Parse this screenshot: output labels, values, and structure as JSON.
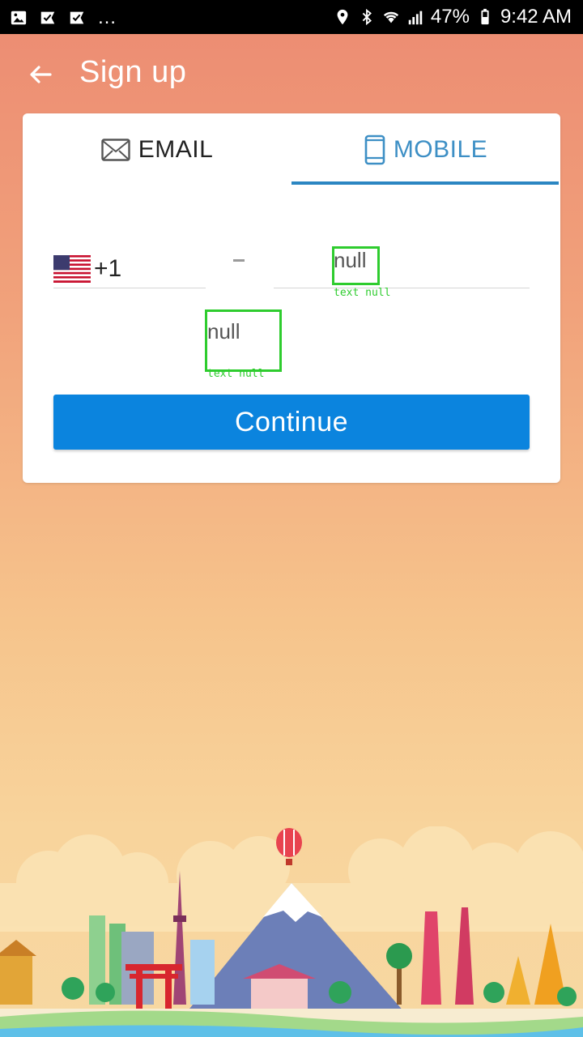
{
  "status_bar": {
    "battery": "47%",
    "time": "9:42 AM",
    "more": "…"
  },
  "header": {
    "title": "Sign up"
  },
  "tabs": [
    {
      "label": "EMAIL",
      "icon": "envelope-icon",
      "selected": false
    },
    {
      "label": "MOBILE",
      "icon": "phone-icon",
      "selected": true
    }
  ],
  "form": {
    "country_code": "+1",
    "country_flag": "us-flag-icon",
    "phone_value": "null",
    "phone_tag": "text null",
    "code_value": "null",
    "code_tag": "text null"
  },
  "continue_label": "Continue",
  "colors": {
    "accent": "#0b84de",
    "tab_selected": "#3d8fc5",
    "annotation": "#2ecc2e"
  }
}
